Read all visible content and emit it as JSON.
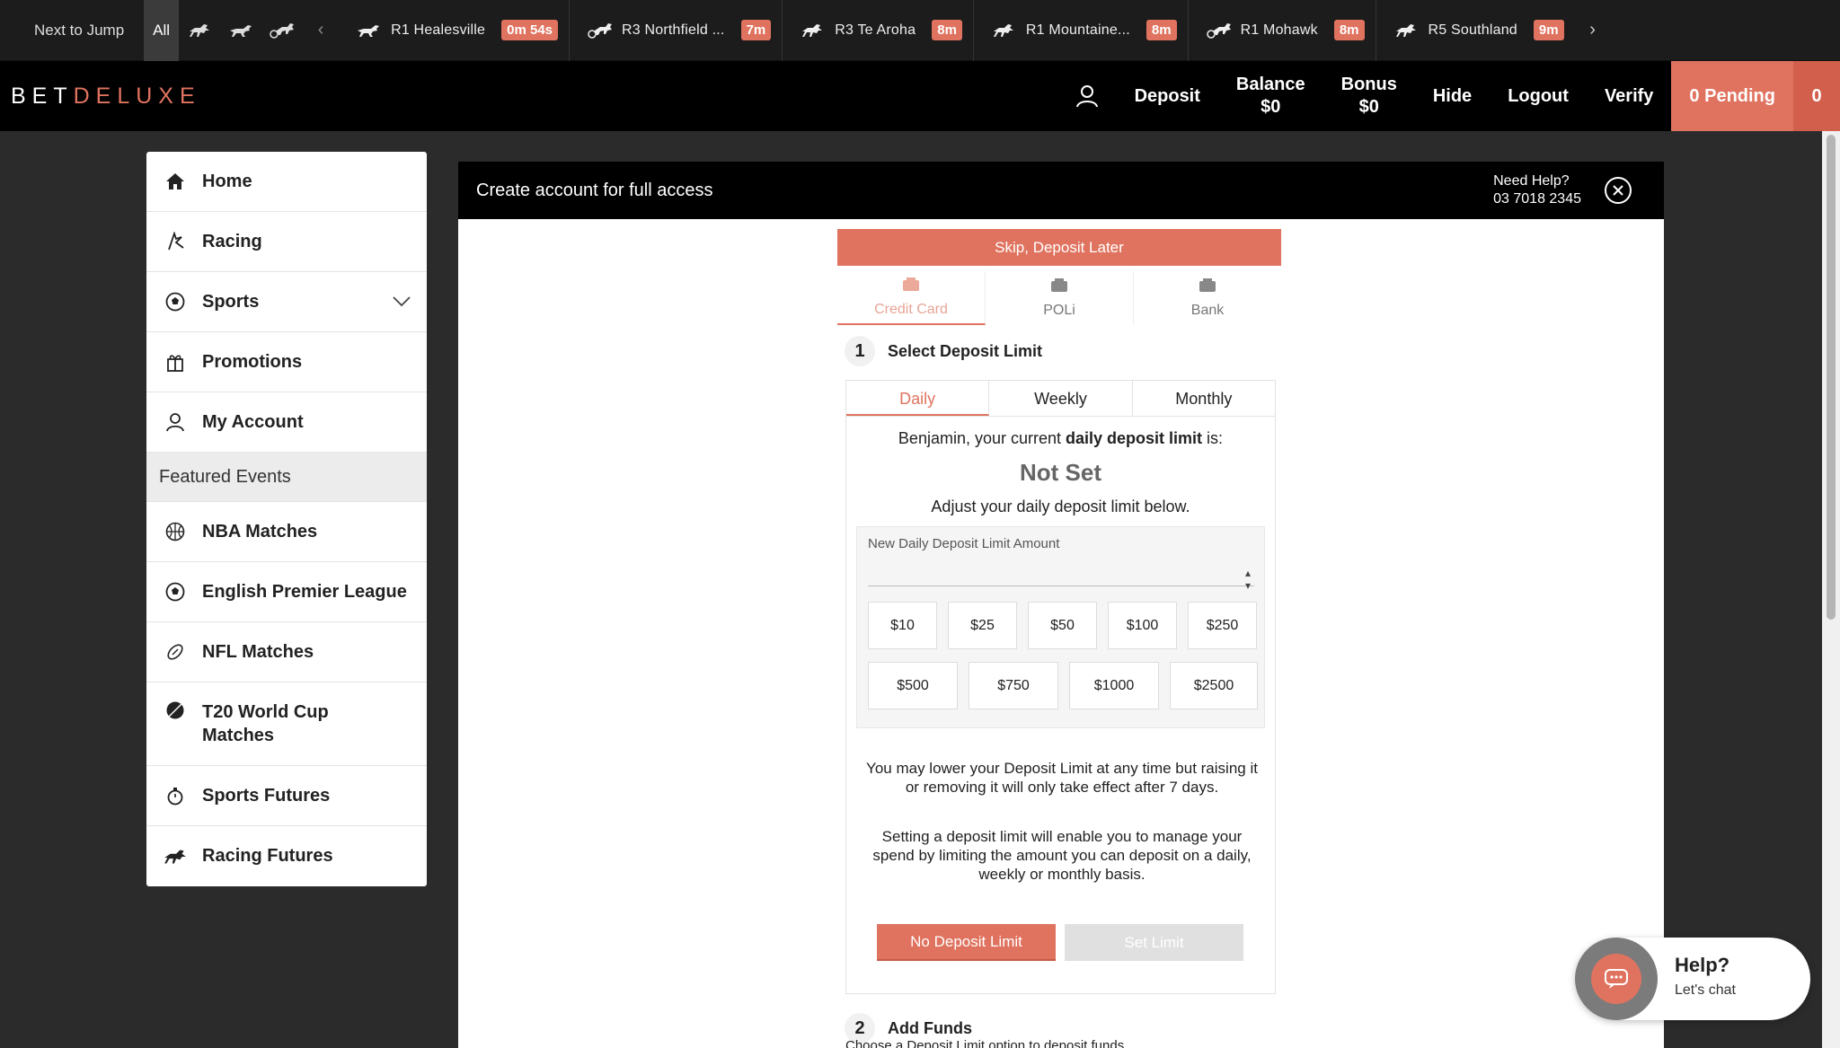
{
  "race_strip": {
    "next_to_jump": "Next to Jump",
    "filter_all": "All",
    "races": [
      {
        "label": "R1  Healesville",
        "time": "0m 54s",
        "icon": "greyhound-icon"
      },
      {
        "label": "R3  Northfield ...",
        "time": "7m",
        "icon": "harness-icon"
      },
      {
        "label": "R3  Te Aroha",
        "time": "8m",
        "icon": "horse-icon"
      },
      {
        "label": "R1  Mountaine...",
        "time": "8m",
        "icon": "horse-icon"
      },
      {
        "label": "R1  Mohawk",
        "time": "8m",
        "icon": "harness-icon"
      },
      {
        "label": "R5  Southland",
        "time": "9m",
        "icon": "horse-icon"
      }
    ]
  },
  "header": {
    "logo_part1": "BET",
    "logo_part2": "DELUXE",
    "deposit": "Deposit",
    "balance_label": "Balance",
    "balance_value": "$0",
    "bonus_label": "Bonus",
    "bonus_value": "$0",
    "hide": "Hide",
    "logout": "Logout",
    "verify": "Verify",
    "pending": "0 Pending",
    "pending_count": "0"
  },
  "sidebar": {
    "items": [
      {
        "label": "Home",
        "icon": "home-icon"
      },
      {
        "label": "Racing",
        "icon": "racing-icon"
      },
      {
        "label": "Sports",
        "icon": "soccer-ball-icon"
      },
      {
        "label": "Promotions",
        "icon": "gift-icon"
      },
      {
        "label": "My Account",
        "icon": "user-icon"
      }
    ],
    "featured_heading": "Featured Events",
    "featured": [
      {
        "label": "NBA Matches",
        "icon": "basketball-icon"
      },
      {
        "label": "English Premier League",
        "icon": "soccer-ball-icon"
      },
      {
        "label": "NFL Matches",
        "icon": "football-icon"
      },
      {
        "label": "T20 World Cup Matches",
        "icon": "cricket-ball-icon"
      },
      {
        "label": "Sports Futures",
        "icon": "stopwatch-icon"
      },
      {
        "label": "Racing Futures",
        "icon": "horse-icon"
      }
    ]
  },
  "panel": {
    "title": "Create account for full access",
    "help_label": "Need Help?",
    "help_phone": "03 7018 2345",
    "skip_button": "Skip, Deposit Later",
    "payment_tabs": [
      "Credit Card",
      "POLi",
      "Bank"
    ],
    "step1_num": "1",
    "step1_title": "Select Deposit Limit",
    "period_tabs": [
      "Daily",
      "Weekly",
      "Monthly"
    ],
    "current_prefix": "Benjamin, your current ",
    "current_bold": "daily deposit limit",
    "current_suffix": " is:",
    "current_value": "Not Set",
    "adjust_text": "Adjust your daily deposit limit below.",
    "amount_label": "New Daily Deposit Limit Amount",
    "amount_value": "",
    "presets_row1": [
      "$10",
      "$25",
      "$50",
      "$100",
      "$250"
    ],
    "presets_row2": [
      "$500",
      "$750",
      "$1000",
      "$2500"
    ],
    "note1": "You may lower your Deposit Limit at any time but raising it or removing it will only take effect after 7 days.",
    "note2": "Setting a deposit limit will enable you to manage your spend by limiting the amount you can deposit on a daily, weekly or monthly basis.",
    "no_limit_button": "No Deposit Limit",
    "set_limit_button": "Set Limit",
    "step2_num": "2",
    "step2_title": "Add Funds",
    "step2_note": "Choose a Deposit Limit option to deposit funds"
  },
  "chat": {
    "title": "Help?",
    "subtitle": "Let's chat"
  },
  "colors": {
    "accent": "#e0735f",
    "header_bg": "#000000",
    "page_bg": "#2b2b2b"
  }
}
